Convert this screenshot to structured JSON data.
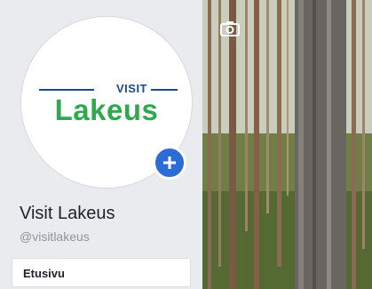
{
  "profile": {
    "logo_top": "VISIT",
    "logo_main": "Lakeus",
    "name": "Visit Lakeus",
    "handle": "@visitlakeus"
  },
  "nav": {
    "items": [
      {
        "label": "Etusivu"
      }
    ]
  },
  "icons": {
    "add": "plus-icon",
    "camera": "camera-icon"
  },
  "colors": {
    "logo_blue": "#1a4b8c",
    "logo_green": "#2fa84f",
    "add_button": "#2d6cd6"
  }
}
